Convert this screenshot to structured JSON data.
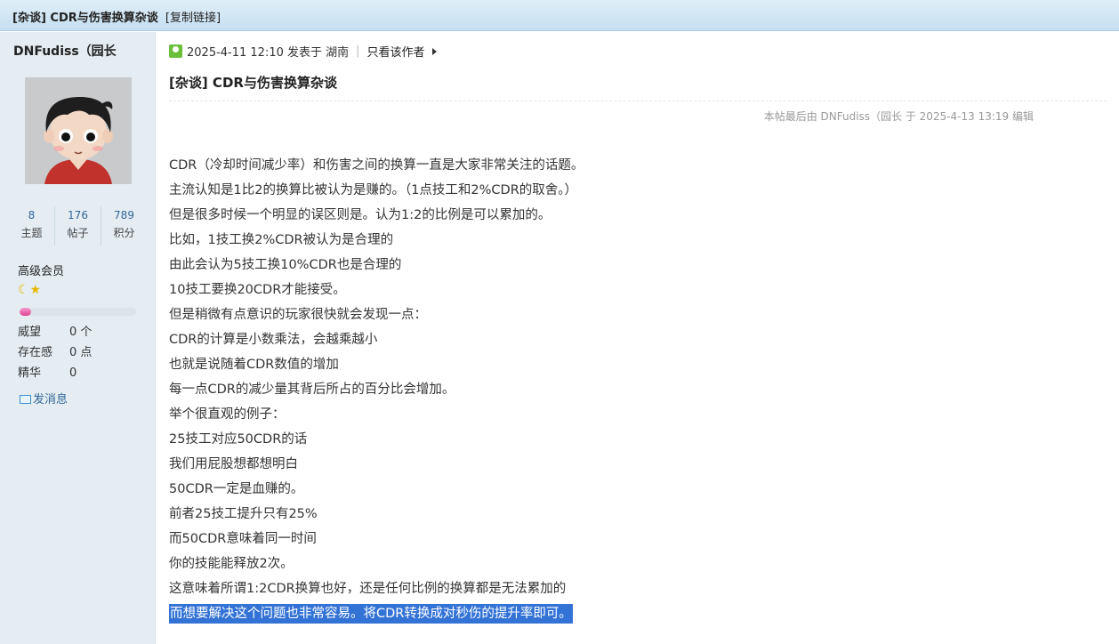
{
  "header": {
    "thread_title": "[杂谈] CDR与伤害换算杂谈",
    "copy_link": "[复制链接]"
  },
  "author": {
    "name": "DNFudiss（园长",
    "stats": [
      {
        "num": "8",
        "label": "主题"
      },
      {
        "num": "176",
        "label": "帖子"
      },
      {
        "num": "789",
        "label": "积分"
      }
    ],
    "rank": "高级会员",
    "rank_icons": "☾★",
    "progress": 0.1,
    "fields": [
      {
        "key": "威望",
        "value": "0 个"
      },
      {
        "key": "存在感",
        "value": "0 点"
      },
      {
        "key": "精华",
        "value": "0"
      }
    ],
    "pm_label": "发消息"
  },
  "post": {
    "meta": "2025-4-11 12:10 发表于 湖南",
    "only_author": "只看该作者",
    "title": "[杂谈] CDR与伤害换算杂谈",
    "edit_note": "本帖最后由 DNFudiss（园长 于 2025-4-13 13:19 编辑",
    "lines": [
      "CDR（冷却时间减少率）和伤害之间的换算一直是大家非常关注的话题。",
      "主流认知是1比2的换算比被认为是赚的。（1点技工和2%CDR的取舍。）",
      "但是很多时候一个明显的误区则是。认为1:2的比例是可以累加的。",
      "比如，1技工换2%CDR被认为是合理的",
      "由此会认为5技工换10%CDR也是合理的",
      "10技工要换20CDR才能接受。",
      "但是稍微有点意识的玩家很快就会发现一点：",
      "CDR的计算是小数乘法，会越乘越小",
      "也就是说随着CDR数值的增加",
      "每一点CDR的减少量其背后所占的百分比会增加。",
      "举个很直观的例子：",
      "25技工对应50CDR的话",
      "我们用屁股想都想明白",
      "50CDR一定是血赚的。",
      "前者25技工提升只有25%",
      "而50CDR意味着同一时间",
      "你的技能能释放2次。",
      "这意味着所谓1:2CDR换算也好，还是任何比例的换算都是无法累加的"
    ],
    "highlighted_line": "而想要解决这个问题也非常容易。将CDR转换成对秒伤的提升率即可。"
  }
}
